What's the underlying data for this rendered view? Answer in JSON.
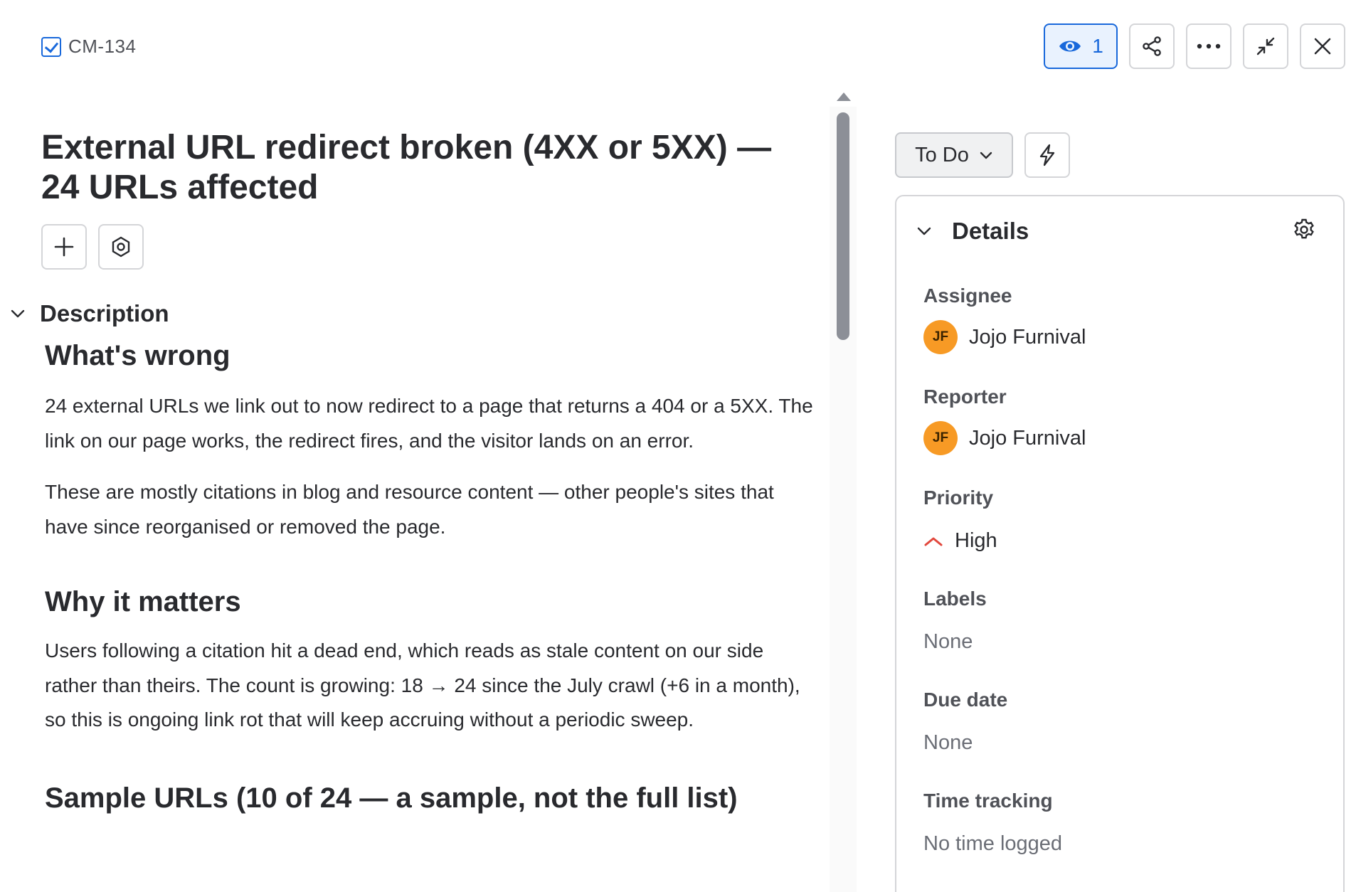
{
  "issue": {
    "key": "CM-134"
  },
  "header": {
    "watch_count": "1",
    "icons": {
      "watch": "eye-icon",
      "share": "share-icon",
      "more": "more-horizontal-icon",
      "minimize": "minimize-icon",
      "close": "close-icon"
    }
  },
  "title": "External URL redirect broken (4XX or 5XX) — 24 URLs affected",
  "description": {
    "label": "Description",
    "heading1": "What's wrong",
    "para1": "24 external URLs we link out to now redirect to a page that returns a 404 or a 5XX. The link on our page works, the redirect fires, and the visitor lands on an error.",
    "para2": "These are mostly citations in blog and resource content — other people's sites that have since reorganised or removed the page.",
    "heading2": "Why it matters",
    "para3": "Users following a citation hit a dead end, which reads as stale content on our side rather than theirs. The count is growing: 18 → 24 since the July crawl (+6 in a month), so this is ongoing link rot that will keep accruing without a periodic sweep.",
    "heading3": "Sample URLs (10 of 24 — a sample, not the full list)"
  },
  "status": {
    "label": "To Do"
  },
  "details": {
    "label": "Details",
    "assignee": {
      "label": "Assignee",
      "initials": "JF",
      "name": "Jojo Furnival"
    },
    "reporter": {
      "label": "Reporter",
      "initials": "JF",
      "name": "Jojo Furnival"
    },
    "priority": {
      "label": "Priority",
      "value": "High"
    },
    "labels": {
      "label": "Labels",
      "value": "None"
    },
    "due_date": {
      "label": "Due date",
      "value": "None"
    },
    "time_tracking": {
      "label": "Time tracking",
      "value": "No time logged"
    }
  },
  "colors": {
    "accent": "#1868db",
    "avatar": "#f79a25",
    "priority_high": "#e2483d"
  }
}
